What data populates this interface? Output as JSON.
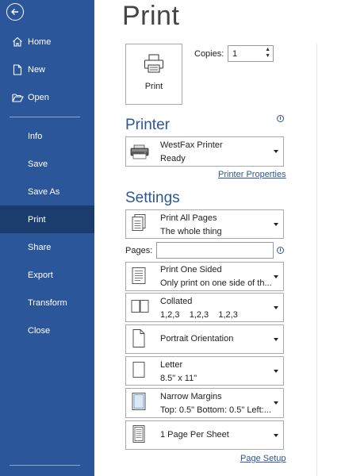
{
  "sidebar": {
    "items": [
      {
        "label": "Home"
      },
      {
        "label": "New"
      },
      {
        "label": "Open"
      },
      {
        "label": "Info"
      },
      {
        "label": "Save"
      },
      {
        "label": "Save As"
      },
      {
        "label": "Print"
      },
      {
        "label": "Share"
      },
      {
        "label": "Export"
      },
      {
        "label": "Transform"
      },
      {
        "label": "Close"
      }
    ],
    "active": "Print",
    "accent": "#2b579a"
  },
  "main": {
    "title": "Print",
    "print_button": "Print",
    "copies_label": "Copies:",
    "copies_value": "1",
    "printer_heading": "Printer",
    "printer_name": "WestFax Printer",
    "printer_status": "Ready",
    "printer_properties": "Printer Properties",
    "settings_heading": "Settings",
    "pages_label": "Pages:",
    "pages_value": "",
    "page_setup": "Page Setup",
    "settings": [
      {
        "line1": "Print All Pages",
        "line2": "The whole thing",
        "icon": "pages-icon"
      },
      {
        "line1": "Print One Sided",
        "line2": "Only print on one side of th...",
        "icon": "one-sided-icon"
      },
      {
        "line1": "Collated",
        "line2": "1,2,3    1,2,3    1,2,3",
        "icon": "collated-icon"
      },
      {
        "line1": "Portrait Orientation",
        "line2": "",
        "icon": "portrait-icon"
      },
      {
        "line1": "Letter",
        "line2": "8.5\" x 11\"",
        "icon": "letter-icon"
      },
      {
        "line1": "Narrow Margins",
        "line2": "Top: 0.5\" Bottom: 0.5\" Left:...",
        "icon": "margins-icon"
      },
      {
        "line1": "1 Page Per Sheet",
        "line2": "",
        "icon": "pages-per-sheet-icon"
      }
    ]
  }
}
